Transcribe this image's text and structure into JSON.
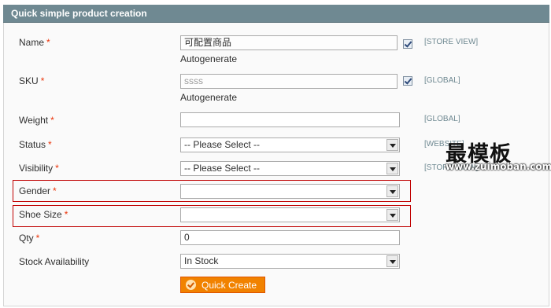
{
  "header": {
    "title": "Quick simple product creation"
  },
  "required_mark": "*",
  "fields": {
    "name": {
      "label": "Name",
      "value": "可配置商品",
      "note": "Autogenerate",
      "scope": "[STORE VIEW]"
    },
    "sku": {
      "label": "SKU",
      "value": "ssss",
      "note": "Autogenerate",
      "scope": "[GLOBAL]"
    },
    "weight": {
      "label": "Weight",
      "value": "",
      "scope": "[GLOBAL]"
    },
    "status": {
      "label": "Status",
      "value": "-- Please Select --",
      "scope": "[WEBSITE]"
    },
    "visibility": {
      "label": "Visibility",
      "value": "-- Please Select --",
      "scope": "[STORE VIEW]"
    },
    "gender": {
      "label": "Gender",
      "value": ""
    },
    "shoe_size": {
      "label": "Shoe Size",
      "value": ""
    },
    "qty": {
      "label": "Qty",
      "value": "0"
    },
    "stock": {
      "label": "Stock Availability",
      "value": "In Stock"
    }
  },
  "button": {
    "label": "Quick Create"
  },
  "watermark": {
    "text": "最模板",
    "url": "www.zuimoban.com"
  },
  "colors": {
    "header_bg": "#6f8992",
    "button_bg": "#f18200",
    "required": "#eb340a",
    "highlight_border": "#c00000"
  }
}
